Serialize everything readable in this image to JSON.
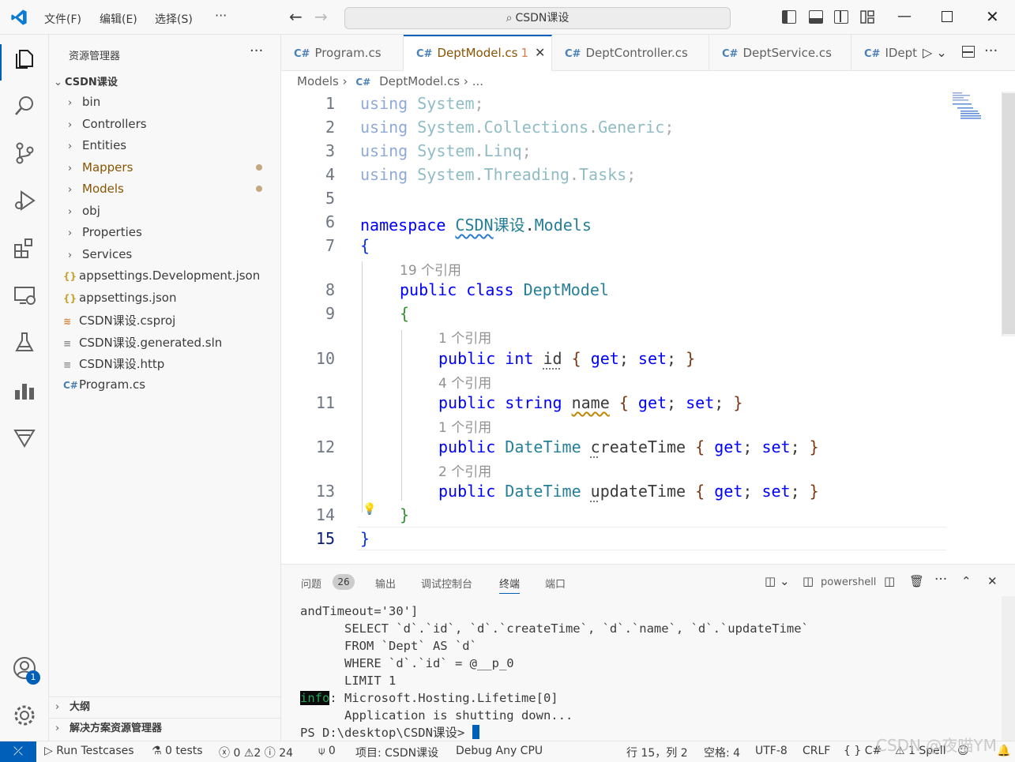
{
  "titlebar": {
    "menus": [
      "文件(F)",
      "编辑(E)",
      "选择(S)",
      "···"
    ],
    "search": "CSDN课设"
  },
  "sidebar": {
    "title": "资源管理器",
    "more": "···",
    "root": "CSDN课设",
    "items": [
      {
        "label": "bin",
        "type": "folder"
      },
      {
        "label": "Controllers",
        "type": "folder"
      },
      {
        "label": "Entities",
        "type": "folder"
      },
      {
        "label": "Mappers",
        "type": "folder",
        "modified": true
      },
      {
        "label": "Models",
        "type": "folder",
        "modified": true
      },
      {
        "label": "obj",
        "type": "folder"
      },
      {
        "label": "Properties",
        "type": "folder"
      },
      {
        "label": "Services",
        "type": "folder"
      },
      {
        "label": "appsettings.Development.json",
        "type": "json"
      },
      {
        "label": "appsettings.json",
        "type": "json"
      },
      {
        "label": "CSDN课设.csproj",
        "type": "rss"
      },
      {
        "label": "CSDN课设.generated.sln",
        "type": "lines"
      },
      {
        "label": "CSDN课设.http",
        "type": "lines"
      },
      {
        "label": "Program.cs",
        "type": "cs"
      }
    ],
    "outline": "大纲",
    "solution": "解决方案资源管理器"
  },
  "tabs": [
    {
      "label": "Program.cs"
    },
    {
      "label": "DeptModel.cs",
      "badge": "1",
      "active": true
    },
    {
      "label": "DeptController.cs"
    },
    {
      "label": "DeptService.cs"
    },
    {
      "label": "IDept"
    }
  ],
  "breadcrumb": {
    "folder": "Models",
    "file": "DeptModel.cs",
    "tail": "..."
  },
  "editor": {
    "line_numbers": [
      "1",
      "2",
      "3",
      "4",
      "5",
      "6",
      "7",
      "8",
      "9",
      "10",
      "11",
      "12",
      "13",
      "14",
      "15"
    ],
    "lens": [
      "19 个引用",
      "1 个引用",
      "4 个引用",
      "1 个引用",
      "2 个引用"
    ]
  },
  "panel": {
    "tabs": [
      "问题",
      "输出",
      "调试控制台",
      "终端",
      "端口"
    ],
    "problems_count": "26",
    "shell": "powershell",
    "terminal": {
      "l1": "andTimeout='30']",
      "l2": "      SELECT `d`.`id`, `d`.`createTime`, `d`.`name`, `d`.`updateTime`",
      "l3": "      FROM `Dept` AS `d`",
      "l4": "      WHERE `d`.`id` = @__p_0",
      "l5": "      LIMIT 1",
      "info": "info",
      "l6": ": Microsoft.Hosting.Lifetime[0]",
      "l7": "      Application is shutting down...",
      "prompt": "PS D:\\desktop\\CSDN课设> "
    }
  },
  "statusbar": {
    "run": "Run Testcases",
    "tests": "0 tests",
    "errors": "0",
    "warnings": "2",
    "infos": "24",
    "ports": "0",
    "project": "项目: CSDN课设",
    "config": "Debug Any CPU",
    "position": "行 15，列 2",
    "indent": "空格: 4",
    "encoding": "UTF-8",
    "eol": "CRLF",
    "lang": "{ } C#",
    "spell": "1 Spell"
  },
  "watermark": "CSDN @夜喵YM",
  "colors": {
    "accent": "#005fb8",
    "keyword": "#0000ff",
    "type": "#267f99"
  }
}
